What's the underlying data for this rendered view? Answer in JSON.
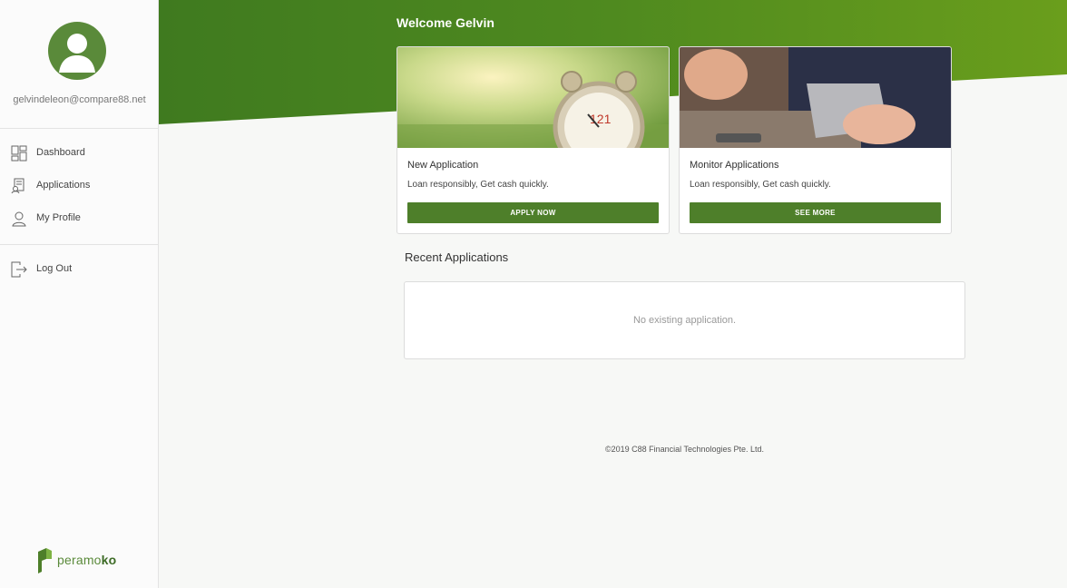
{
  "user": {
    "email": "gelvindeleon@compare88.net"
  },
  "sidebar": {
    "items": [
      {
        "label": "Dashboard",
        "icon": "dashboard-icon"
      },
      {
        "label": "Applications",
        "icon": "applications-icon"
      },
      {
        "label": "My Profile",
        "icon": "profile-icon"
      }
    ],
    "logout": {
      "label": "Log Out",
      "icon": "logout-icon"
    }
  },
  "logo": {
    "text_light": "peramo",
    "text_bold": "ko"
  },
  "main": {
    "welcome": "Welcome Gelvin",
    "cards": [
      {
        "title": "New Application",
        "description": "Loan responsibly, Get cash quickly.",
        "button": "APPLY NOW"
      },
      {
        "title": "Monitor Applications",
        "description": "Loan responsibly, Get cash quickly.",
        "button": "SEE MORE"
      }
    ],
    "recent": {
      "title": "Recent Applications",
      "empty_text": "No existing application."
    }
  },
  "footer": {
    "text": "©2019 C88 Financial Technologies Pte. Ltd."
  },
  "colors": {
    "accent": "#4e7f2a",
    "hero_green": "#5b8f22"
  }
}
